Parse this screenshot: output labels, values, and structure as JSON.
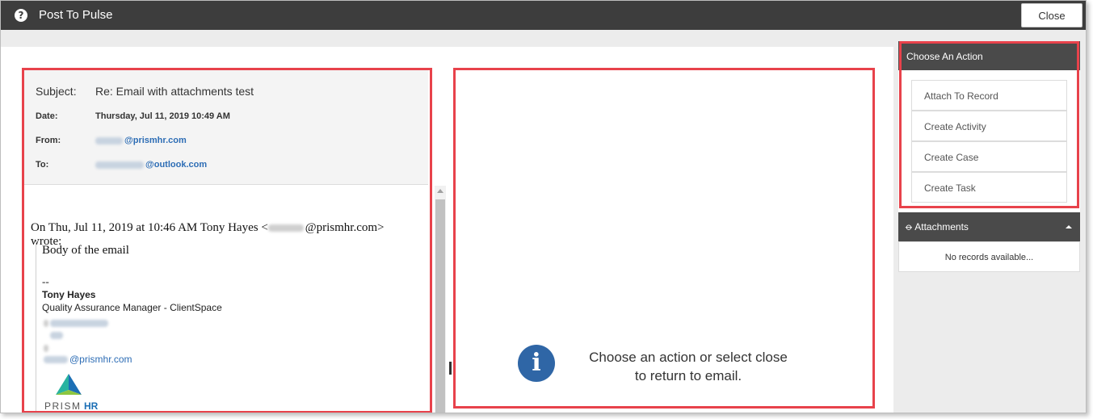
{
  "window": {
    "title": "Post To Pulse",
    "close_label": "Close"
  },
  "email": {
    "subject_label": "Subject:",
    "subject": "Re: Email with attachments test",
    "date_label": "Date:",
    "date": "Thursday, Jul 11, 2019 10:49 AM",
    "from_label": "From:",
    "from_domain": "@prismhr.com",
    "to_label": "To:",
    "to_domain": "@outlook.com",
    "quote_intro_pre": "On Thu, Jul 11, 2019 at 10:46 AM Tony Hayes <",
    "quote_intro_domain": "@prismhr.com>",
    "quote_intro_wrote": "wrote:",
    "body_text": "Body of the email",
    "sig_dash": "--",
    "sig_name": "Tony Hayes",
    "sig_title": "Quality Assurance Manager - ClientSpace",
    "sig_email_domain": "@prismhr.com",
    "logo_text_left": "PRISM",
    "logo_text_right": "HR"
  },
  "action_panel": {
    "info_text": "Choose an action or select close to return to email."
  },
  "sidebar": {
    "header": "Choose An Action",
    "actions": [
      {
        "label": "Attach To Record"
      },
      {
        "label": "Create Activity"
      },
      {
        "label": "Create Case"
      },
      {
        "label": "Create Task"
      }
    ],
    "attachments_header": "Attachments",
    "attachments_empty": "No records available..."
  },
  "colors": {
    "highlight": "#e8424b",
    "header_bg": "#4a4a4a",
    "titlebar_bg": "#3d3d3d",
    "link": "#2d6db5",
    "info_icon": "#2f66a6"
  },
  "icons": {
    "help": "question-circle-icon",
    "info": "info-circle-icon",
    "attachments": "paperclip-icon",
    "collapse": "caret-up-icon"
  }
}
